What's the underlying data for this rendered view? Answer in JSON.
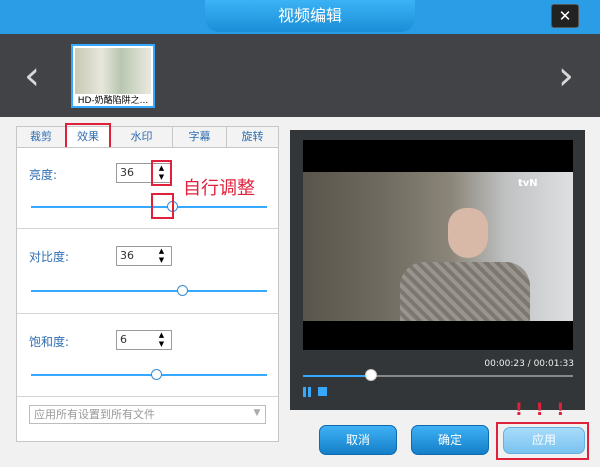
{
  "window": {
    "title": "视频编辑",
    "close_glyph": "✕"
  },
  "filmstrip": {
    "prev_icon": "chevron-left-icon",
    "next_icon": "chevron-right-icon",
    "items": [
      {
        "label": "HD-奶酪陷阱之...",
        "selected": true
      }
    ]
  },
  "tabs": [
    {
      "label": "裁剪"
    },
    {
      "label": "效果",
      "active": true
    },
    {
      "label": "水印"
    },
    {
      "label": "字幕"
    },
    {
      "label": "旋转"
    }
  ],
  "effects": {
    "brightness": {
      "label": "亮度:",
      "value": "36",
      "level": 0.6
    },
    "contrast": {
      "label": "对比度:",
      "value": "36",
      "level": 0.64
    },
    "saturation": {
      "label": "饱和度:",
      "value": "6",
      "level": 0.53
    }
  },
  "annotation": {
    "note": "自行调整",
    "exclaim": "!!!",
    "highlight_color": "#e0213c"
  },
  "apply_all": {
    "value": "应用所有设置到所有文件"
  },
  "player": {
    "logo": "tvN",
    "time": "00:00:23 / 00:01:33",
    "progress": 0.25
  },
  "buttons": {
    "cancel": "取消",
    "confirm": "确定",
    "apply": "应用"
  },
  "colors": {
    "accent": "#2b9de6",
    "link": "#2f6db1"
  }
}
